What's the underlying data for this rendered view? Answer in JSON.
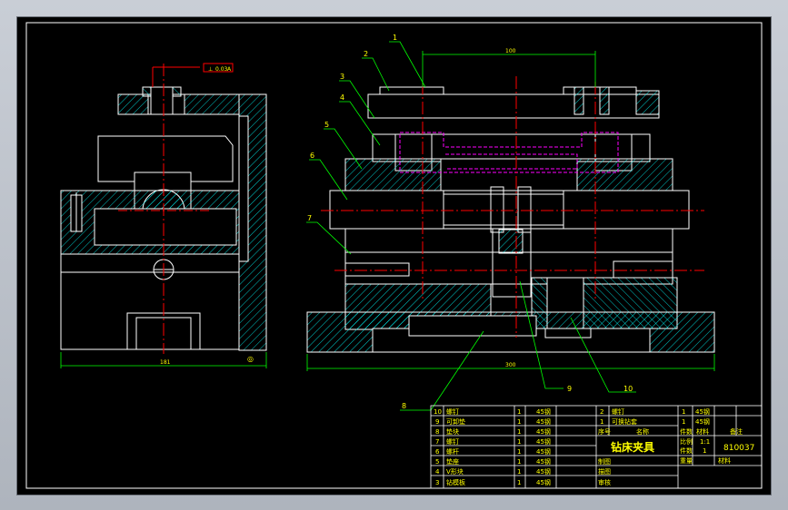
{
  "drawing": {
    "title": "钻床夹具",
    "drawing_number": "810037",
    "colors": {
      "background": "#000000",
      "outline": "#ffffff",
      "hatch": "#00ffff",
      "center": "#ff0000",
      "hidden": "#ff00ff",
      "leader": "#00ff00",
      "text": "#ffff00"
    }
  },
  "callouts": [
    "1",
    "2",
    "3",
    "4",
    "5",
    "6",
    "7",
    "8",
    "9",
    "10"
  ],
  "dimensions": {
    "left_width": "181",
    "right_width": "300",
    "top_span": "100",
    "tolerance_frame": [
      "⊥",
      "0.03",
      "A"
    ]
  },
  "bom": {
    "left": [
      {
        "no": "10",
        "name": "螺钉",
        "qty": "1",
        "material": "45钢"
      },
      {
        "no": "9",
        "name": "可卸垫",
        "qty": "1",
        "material": "45钢"
      },
      {
        "no": "8",
        "name": "垫块",
        "qty": "1",
        "material": "45钢"
      },
      {
        "no": "7",
        "name": "螺钉",
        "qty": "1",
        "material": "45钢"
      },
      {
        "no": "6",
        "name": "螺杆",
        "qty": "1",
        "material": "45钢"
      },
      {
        "no": "5",
        "name": "垫座",
        "qty": "1",
        "material": "45钢"
      },
      {
        "no": "4",
        "name": "V形块",
        "qty": "1",
        "material": "45钢"
      },
      {
        "no": "3",
        "name": "钻模板",
        "qty": "1",
        "material": "45钢"
      }
    ],
    "right": [
      {
        "no": "2",
        "name": "螺钉",
        "qty": "1",
        "material": "45钢"
      },
      {
        "no": "1",
        "name": "可换钻套",
        "qty": "1",
        "material": "45钢"
      }
    ],
    "header": {
      "no": "序号",
      "name": "名称",
      "qty": "件数",
      "material": "材料",
      "remark": "备注"
    },
    "info": {
      "scale_label": "比例",
      "scale_value": "1:1",
      "qty_label": "件数",
      "qty_value": "1",
      "weight_label": "重量",
      "material_label": "材料",
      "drawn": "制图",
      "checked": "描图",
      "approved": "审核"
    }
  }
}
